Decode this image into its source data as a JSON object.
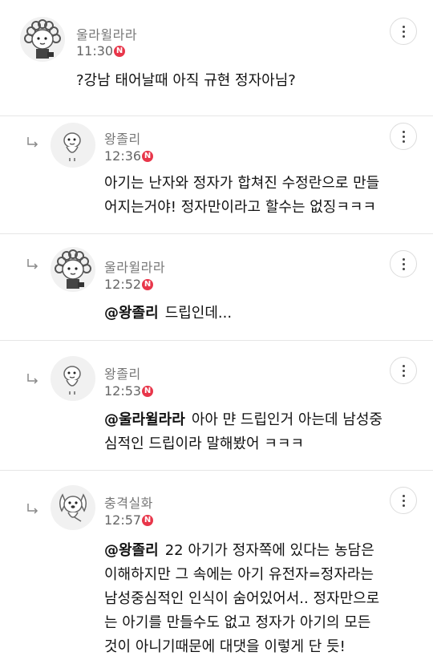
{
  "comments": [
    {
      "nickname": "울라윌라라",
      "time": "11:30",
      "badge": "N",
      "is_reply": false,
      "mention": "",
      "lines": [
        "?강남 태어날때 아직 규현 정자아님?"
      ],
      "avatar_icon": "curly-hair-character-icon"
    },
    {
      "nickname": "왕졸리",
      "time": "12:36",
      "badge": "N",
      "is_reply": true,
      "mention": "",
      "lines": [
        "아기는 난자와 정자가 합쳐진 수정란으로 만들",
        "어지는거야! 정자만이라고 할수는 없징ㅋㅋㅋ"
      ],
      "avatar_icon": "round-character-icon"
    },
    {
      "nickname": "울라윌라라",
      "time": "12:52",
      "badge": "N",
      "is_reply": true,
      "mention": "@왕졸리",
      "lines": [
        "드립인데..."
      ],
      "avatar_icon": "curly-hair-character-icon"
    },
    {
      "nickname": "왕졸리",
      "time": "12:53",
      "badge": "N",
      "is_reply": true,
      "mention": "@울라윌라라",
      "lines": [
        "아아 먄 드립인거 아는데 남성중",
        "심적인 드립이라 말해봤어 ㅋㅋㅋ"
      ],
      "avatar_icon": "round-character-icon"
    },
    {
      "nickname": "충격실화",
      "time": "12:57",
      "badge": "N",
      "is_reply": true,
      "mention": "@왕졸리",
      "lines": [
        "22 아기가 정자쪽에 있다는 농담은",
        "이해하지만 그 속에는 아기 유전자=정자라는",
        "남성중심적인 인식이 숨어있어서.. 정자만으로",
        "는 아기를 만들수도 없고 정자가 아기의 모든",
        "것이 아니기때문에 대댓을 이렇게 단 듯!"
      ],
      "avatar_icon": "dog-character-icon"
    }
  ],
  "colors": {
    "badge": "#e8364a",
    "divider": "#e6e6e6",
    "nickname": "#777777"
  }
}
